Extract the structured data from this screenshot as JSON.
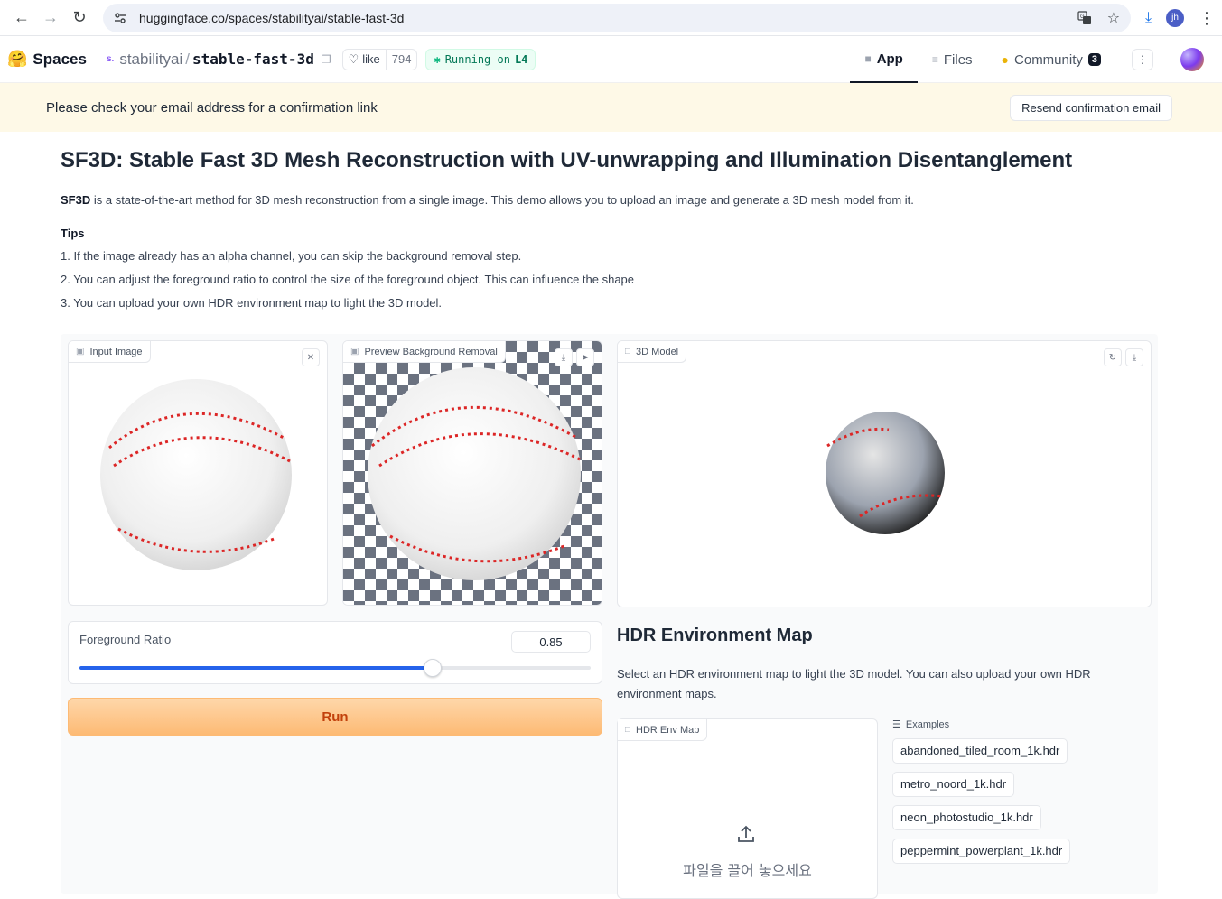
{
  "browser": {
    "url": "huggingface.co/spaces/stabilityai/stable-fast-3d",
    "profile_initials": "jh"
  },
  "hf": {
    "spaces_label": "Spaces",
    "org_badge": "s.",
    "org": "stabilityai",
    "repo": "stable-fast-3d",
    "like_label": "like",
    "like_count": "794",
    "running_prefix": "Running on",
    "running_hw": "L4",
    "tabs": [
      {
        "label": "App"
      },
      {
        "label": "Files"
      },
      {
        "label": "Community",
        "badge": "3"
      }
    ]
  },
  "banner": {
    "message": "Please check your email address for a confirmation link",
    "button": "Resend confirmation email"
  },
  "content": {
    "title": "SF3D: Stable Fast 3D Mesh Reconstruction with UV-unwrapping and Illumination Disentanglement",
    "desc_bold": "SF3D",
    "desc_rest": " is a state-of-the-art method for 3D mesh reconstruction from a single image. This demo allows you to upload an image and generate a 3D mesh model from it.",
    "tips_heading": "Tips",
    "tips": [
      "1. If the image already has an alpha channel, you can skip the background removal step.",
      "2. You can adjust the foreground ratio to control the size of the foreground object. This can influence the shape",
      "3. You can upload your own HDR environment map to light the 3D model."
    ]
  },
  "app": {
    "input_label": "Input Image",
    "preview_label": "Preview Background Removal",
    "model_label": "3D Model",
    "slider_label": "Foreground Ratio",
    "slider_value": "0.85",
    "slider_fraction": 0.69,
    "run_label": "Run",
    "hdr_title": "HDR Environment Map",
    "hdr_desc": "Select an HDR environment map to light the 3D model. You can also upload your own HDR environment maps.",
    "hdr_panel_label": "HDR Env Map",
    "upload_text": "파일을 끌어 놓으세요",
    "examples_label": "Examples",
    "examples": [
      "abandoned_tiled_room_1k.hdr",
      "metro_noord_1k.hdr",
      "neon_photostudio_1k.hdr",
      "peppermint_powerplant_1k.hdr"
    ]
  },
  "colors": {
    "accent": "#2563eb",
    "run_bg": "#fdba74",
    "run_text": "#c2410c",
    "banner_bg": "#fef9e7"
  }
}
